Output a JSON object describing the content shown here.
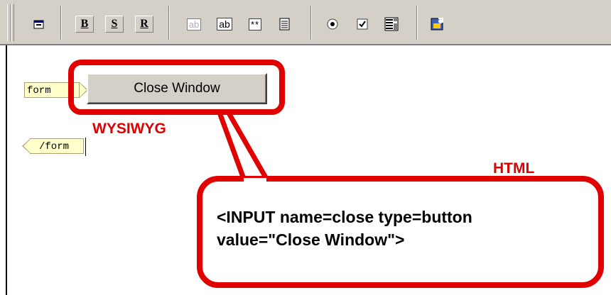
{
  "toolbar": {
    "buttons": [
      {
        "name": "form-properties-icon",
        "kind": "icon"
      },
      {
        "name": "bold-button",
        "label": "B"
      },
      {
        "name": "strike-button",
        "label": "S"
      },
      {
        "name": "reset-button",
        "label": "R"
      },
      {
        "name": "text-field-disabled-icon",
        "label": "ab"
      },
      {
        "name": "text-field-icon",
        "label": "ab"
      },
      {
        "name": "password-field-icon",
        "label": "**"
      },
      {
        "name": "textarea-icon",
        "kind": "icon"
      },
      {
        "name": "radio-button-icon",
        "kind": "icon"
      },
      {
        "name": "checkbox-icon",
        "kind": "icon"
      },
      {
        "name": "listbox-icon",
        "kind": "icon"
      },
      {
        "name": "image-button-icon",
        "kind": "icon"
      }
    ]
  },
  "editor": {
    "form_open_tag": "form",
    "form_close_tag": "/form",
    "button_value": "Close Window"
  },
  "annotations": {
    "wysiwyg_label": "WYSIWYG",
    "html_label": "HTML",
    "html_code_line1": "<INPUT name=close type=button",
    "html_code_line2": "value=\"Close Window\">",
    "accent_color": "#e00000"
  }
}
